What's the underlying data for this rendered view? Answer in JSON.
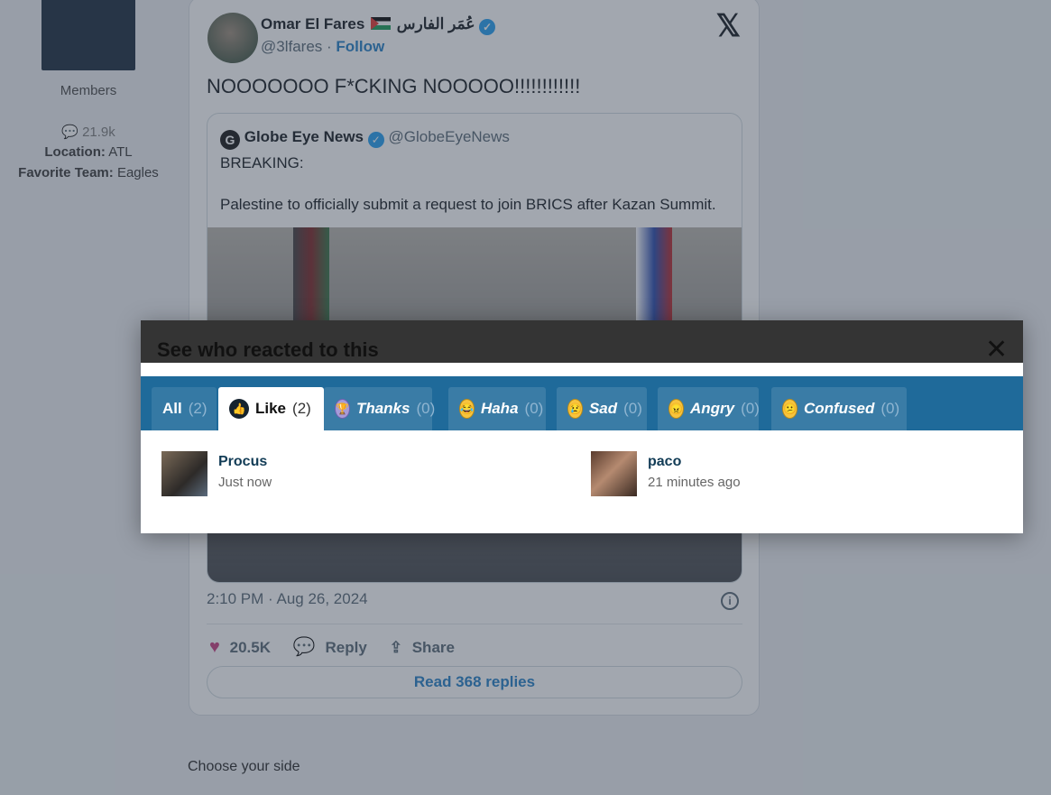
{
  "sidebar": {
    "group": "Members",
    "messages": "21.9k",
    "location_label": "Location:",
    "location_value": "ATL",
    "team_label": "Favorite Team:",
    "team_value": "Eagles"
  },
  "tweet": {
    "author_name": "Omar El Fares",
    "author_name_ar": "عُمَر الفارس",
    "handle": "@3lfares",
    "follow_label": "Follow",
    "text": "NOOOOOOO F*CKING NOOOOO!!!!!!!!!!!!",
    "quote": {
      "source_name": "Globe Eye News",
      "source_handle": "@GlobeEyeNews",
      "breaking": "BREAKING:",
      "body": "Palestine to officially submit a request to join BRICS after Kazan Summit."
    },
    "timestamp": "2:10 PM · Aug 26, 2024",
    "likes": "20.5K",
    "reply_label": "Reply",
    "share_label": "Share",
    "read_replies_label": "Read 368 replies"
  },
  "post_footer": "Choose your side",
  "modal": {
    "title": "See who reacted to this",
    "close_glyph": "✕",
    "tabs": [
      {
        "label": "All",
        "count": "(2)"
      },
      {
        "label": "Like",
        "count": "(2)"
      },
      {
        "label": "Thanks",
        "count": "(0)"
      },
      {
        "label": "Haha",
        "count": "(0)"
      },
      {
        "label": "Sad",
        "count": "(0)"
      },
      {
        "label": "Angry",
        "count": "(0)"
      },
      {
        "label": "Confused",
        "count": "(0)"
      }
    ],
    "users": [
      {
        "name": "Procus",
        "time": "Just now"
      },
      {
        "name": "paco",
        "time": "21 minutes ago"
      }
    ]
  },
  "colors": {
    "tab_bar": "#1f6a9a",
    "modal_header": "#343434",
    "username": "#123c56",
    "link_blue": "#1d7bc4"
  }
}
